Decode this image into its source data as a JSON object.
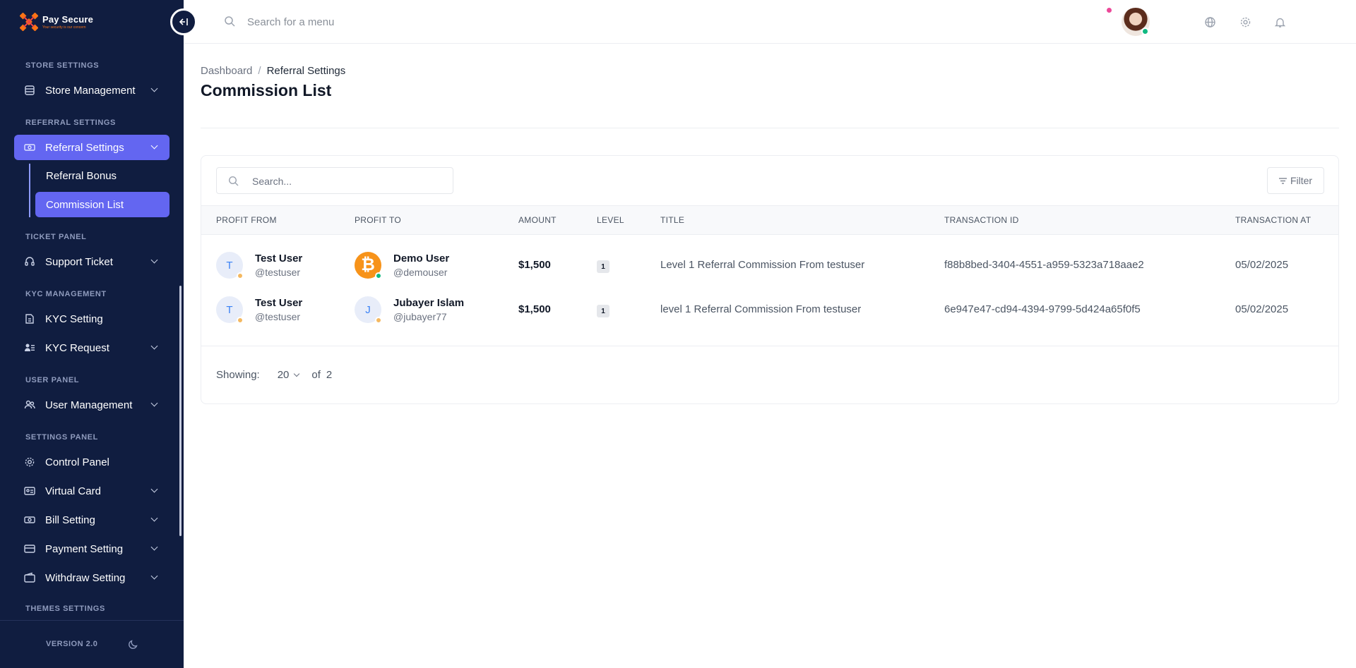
{
  "brand": {
    "name": "Pay Secure",
    "tagline": "Your security is our concern"
  },
  "header": {
    "search_placeholder": "Search for a menu",
    "icons": [
      "globe-icon",
      "gear-icon",
      "bell-icon"
    ],
    "notification_dot_color": "#ec4899"
  },
  "sidebar": {
    "sections": [
      {
        "label": "STORE SETTINGS"
      },
      {
        "label": "REFERRAL SETTINGS"
      },
      {
        "label": "TICKET PANEL"
      },
      {
        "label": "KYC MANAGEMENT"
      },
      {
        "label": "USER PANEL"
      },
      {
        "label": "SETTINGS PANEL"
      },
      {
        "label": "THEMES SETTINGS"
      }
    ],
    "items": [
      {
        "label": "Store Management",
        "icon": "store-icon"
      },
      {
        "label": "Referral Settings",
        "icon": "money-icon"
      },
      {
        "label": "Support Ticket",
        "icon": "headset-icon"
      },
      {
        "label": "KYC Setting",
        "icon": "document-icon"
      },
      {
        "label": "KYC Request",
        "icon": "users-list-icon"
      },
      {
        "label": "User Management",
        "icon": "users-icon"
      },
      {
        "label": "Control Panel",
        "icon": "gear-icon"
      },
      {
        "label": "Virtual Card",
        "icon": "id-card-icon"
      },
      {
        "label": "Bill Setting",
        "icon": "bill-icon"
      },
      {
        "label": "Payment Setting",
        "icon": "card-icon"
      },
      {
        "label": "Withdraw Setting",
        "icon": "wallet-icon"
      }
    ],
    "sub_items": [
      {
        "label": "Referral Bonus"
      },
      {
        "label": "Commission List"
      }
    ],
    "version": "VERSION 2.0",
    "accent_color": "#6366f1",
    "background_color": "#101d40"
  },
  "breadcrumb": {
    "root": "Dashboard",
    "separator": "/",
    "current": "Referral Settings"
  },
  "page": {
    "title": "Commission List"
  },
  "table": {
    "search_placeholder": "Search...",
    "filter_label": "Filter",
    "columns": [
      "PROFIT FROM",
      "PROFIT TO",
      "AMOUNT",
      "LEVEL",
      "TITLE",
      "TRANSACTION ID",
      "TRANSACTION AT"
    ],
    "rows": [
      {
        "from": {
          "initial": "T",
          "name": "Test User",
          "handle": "@testuser"
        },
        "to": {
          "initial": "₿",
          "name": "Demo User",
          "handle": "@demouser"
        },
        "amount": "$1,500",
        "level": "1",
        "title": "Level 1 Referral Commission From testuser",
        "transaction_id": "f88b8bed-3404-4551-a959-5323a718aae2",
        "transaction_at": "05/02/2025"
      },
      {
        "from": {
          "initial": "T",
          "name": "Test User",
          "handle": "@testuser"
        },
        "to": {
          "initial": "J",
          "name": "Jubayer Islam",
          "handle": "@jubayer77"
        },
        "amount": "$1,500",
        "level": "1",
        "title": "level 1 Referral Commission From testuser",
        "transaction_id": "6e947e47-cd94-4394-9799-5d424a65f0f5",
        "transaction_at": "05/02/2025"
      }
    ]
  },
  "pagination": {
    "showing_label": "Showing:",
    "per_page": "20",
    "of_label": "of",
    "total": "2"
  }
}
